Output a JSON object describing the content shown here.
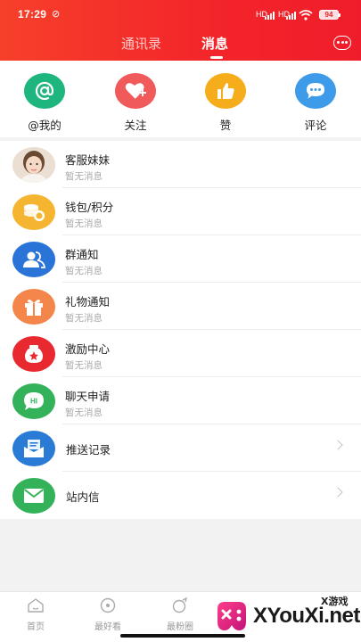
{
  "status_bar": {
    "time": "17:29",
    "battery": "94",
    "network_1": "HD",
    "network_2": "HD"
  },
  "header": {
    "tabs": [
      {
        "label": "通讯录"
      },
      {
        "label": "消息"
      }
    ]
  },
  "quick_actions": [
    {
      "label": "@我的",
      "icon": "at-icon",
      "color": "#1fb57e"
    },
    {
      "label": "关注",
      "icon": "heart-plus-icon",
      "color": "#f05a5a"
    },
    {
      "label": "赞",
      "icon": "thumbs-up-icon",
      "color": "#f6ad1b"
    },
    {
      "label": "评论",
      "icon": "comment-icon",
      "color": "#3d9be9"
    }
  ],
  "messages": [
    {
      "title": "客服妹妹",
      "subtitle": "暂无消息",
      "icon": "customer-service-avatar"
    },
    {
      "title": "钱包/积分",
      "subtitle": "暂无消息",
      "icon": "coins-icon",
      "color": "#f6b531"
    },
    {
      "title": "群通知",
      "subtitle": "暂无消息",
      "icon": "group-icon",
      "color": "#2a74d8"
    },
    {
      "title": "礼物通知",
      "subtitle": "暂无消息",
      "icon": "gift-icon",
      "color": "#f5864b"
    },
    {
      "title": "激励中心",
      "subtitle": "暂无消息",
      "icon": "reward-icon",
      "color": "#e8292f"
    },
    {
      "title": "聊天申请",
      "subtitle": "暂无消息",
      "icon": "chat-hi-icon",
      "color": "#34b25a"
    }
  ],
  "links": [
    {
      "title": "推送记录",
      "icon": "mail-open-icon",
      "color": "#2a7bd5"
    },
    {
      "title": "站内信",
      "icon": "envelope-icon",
      "color": "#34b25a"
    }
  ],
  "bottom_nav": [
    {
      "label": "首页"
    },
    {
      "label": "最好看"
    },
    {
      "label": "最粉圈"
    }
  ],
  "watermark": {
    "text": "XYouXi.net",
    "sub": "X游戏"
  }
}
